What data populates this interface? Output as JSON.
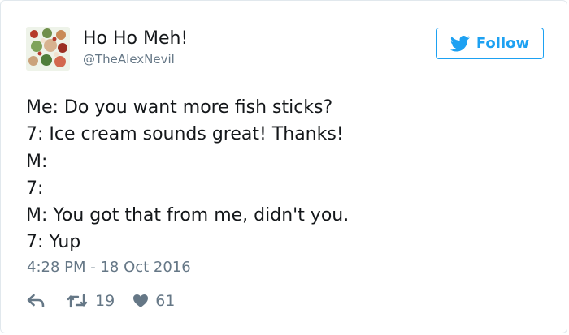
{
  "tweet": {
    "user": {
      "name": "Ho Ho Meh!",
      "handle": "@TheAlexNevil"
    },
    "follow_label": "Follow",
    "lines": [
      "Me: Do you want more fish sticks?",
      "7: Ice cream sounds great! Thanks!",
      "M:",
      "7:",
      "M: You got that from me, didn't you.",
      "7: Yup"
    ],
    "timestamp": "4:28 PM - 18 Oct 2016",
    "retweet_count": "19",
    "like_count": "61"
  },
  "icons": {
    "follow": "twitter-bird-icon",
    "reply": "reply-icon",
    "retweet": "retweet-icon",
    "like": "heart-icon"
  },
  "colors": {
    "brand": "#1da1f2",
    "text": "#14171a",
    "secondary": "#657786",
    "border": "#e1e8ed"
  }
}
